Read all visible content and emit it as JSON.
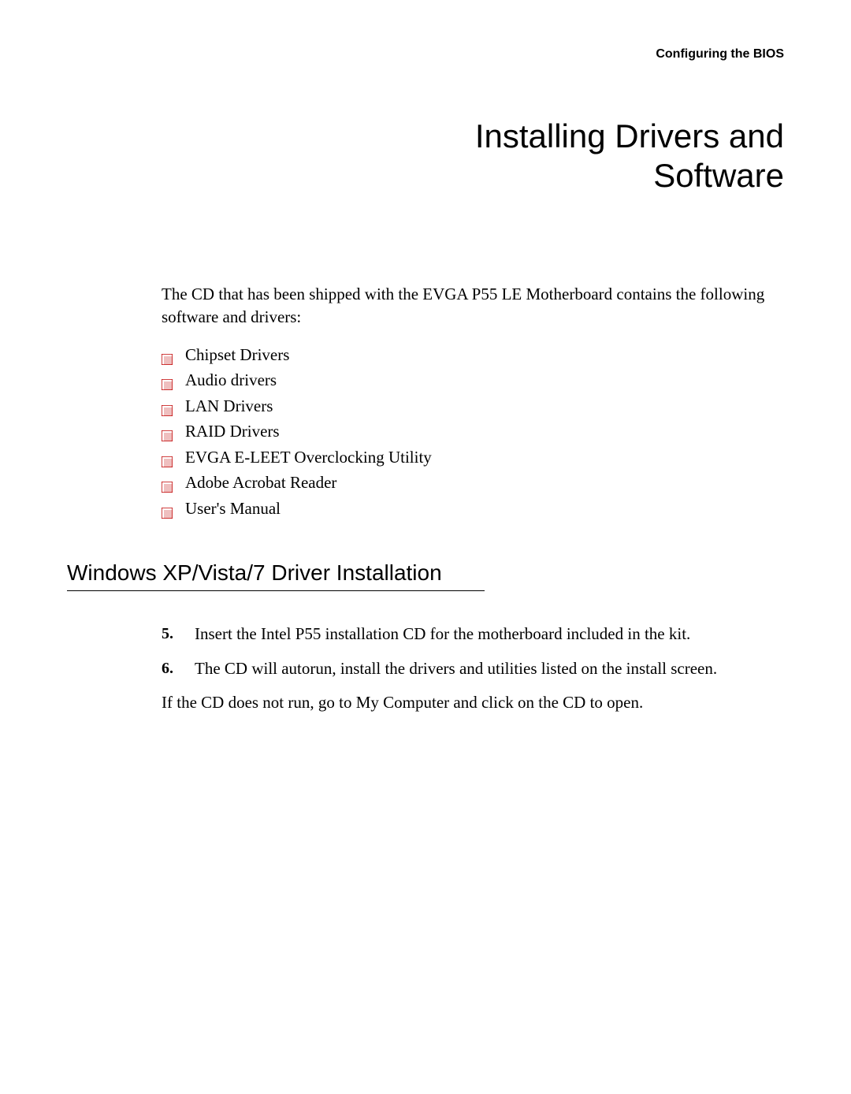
{
  "header": {
    "breadcrumb": "Configuring the BIOS"
  },
  "title": {
    "line1": "Installing Drivers and",
    "line2": "Software"
  },
  "intro": "The CD that has been shipped with the EVGA P55 LE Motherboard contains the following software and drivers:",
  "bullets": [
    "Chipset Drivers",
    "Audio drivers",
    "LAN Drivers",
    "RAID Drivers",
    "EVGA E-LEET Overclocking Utility",
    "Adobe Acrobat Reader",
    "User's Manual"
  ],
  "section": {
    "heading": "Windows XP/Vista/7 Driver Installation"
  },
  "steps": [
    {
      "number": "5.",
      "text": "Insert the Intel P55 installation CD for the motherboard included in the kit."
    },
    {
      "number": "6.",
      "text": "The CD will autorun, install the drivers and utilities listed on the install screen."
    }
  ],
  "closing": "If the CD does not run, go to My Computer and click on the CD to open."
}
